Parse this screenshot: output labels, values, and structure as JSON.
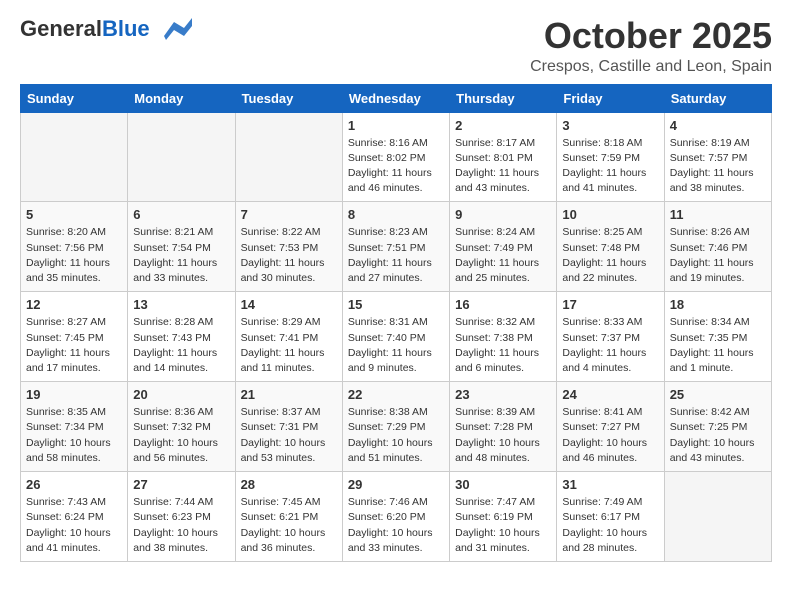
{
  "header": {
    "logo_general": "General",
    "logo_blue": "Blue",
    "month": "October 2025",
    "location": "Crespos, Castille and Leon, Spain"
  },
  "days_of_week": [
    "Sunday",
    "Monday",
    "Tuesday",
    "Wednesday",
    "Thursday",
    "Friday",
    "Saturday"
  ],
  "weeks": [
    [
      {
        "day": "",
        "info": ""
      },
      {
        "day": "",
        "info": ""
      },
      {
        "day": "",
        "info": ""
      },
      {
        "day": "1",
        "info": "Sunrise: 8:16 AM\nSunset: 8:02 PM\nDaylight: 11 hours\nand 46 minutes."
      },
      {
        "day": "2",
        "info": "Sunrise: 8:17 AM\nSunset: 8:01 PM\nDaylight: 11 hours\nand 43 minutes."
      },
      {
        "day": "3",
        "info": "Sunrise: 8:18 AM\nSunset: 7:59 PM\nDaylight: 11 hours\nand 41 minutes."
      },
      {
        "day": "4",
        "info": "Sunrise: 8:19 AM\nSunset: 7:57 PM\nDaylight: 11 hours\nand 38 minutes."
      }
    ],
    [
      {
        "day": "5",
        "info": "Sunrise: 8:20 AM\nSunset: 7:56 PM\nDaylight: 11 hours\nand 35 minutes."
      },
      {
        "day": "6",
        "info": "Sunrise: 8:21 AM\nSunset: 7:54 PM\nDaylight: 11 hours\nand 33 minutes."
      },
      {
        "day": "7",
        "info": "Sunrise: 8:22 AM\nSunset: 7:53 PM\nDaylight: 11 hours\nand 30 minutes."
      },
      {
        "day": "8",
        "info": "Sunrise: 8:23 AM\nSunset: 7:51 PM\nDaylight: 11 hours\nand 27 minutes."
      },
      {
        "day": "9",
        "info": "Sunrise: 8:24 AM\nSunset: 7:49 PM\nDaylight: 11 hours\nand 25 minutes."
      },
      {
        "day": "10",
        "info": "Sunrise: 8:25 AM\nSunset: 7:48 PM\nDaylight: 11 hours\nand 22 minutes."
      },
      {
        "day": "11",
        "info": "Sunrise: 8:26 AM\nSunset: 7:46 PM\nDaylight: 11 hours\nand 19 minutes."
      }
    ],
    [
      {
        "day": "12",
        "info": "Sunrise: 8:27 AM\nSunset: 7:45 PM\nDaylight: 11 hours\nand 17 minutes."
      },
      {
        "day": "13",
        "info": "Sunrise: 8:28 AM\nSunset: 7:43 PM\nDaylight: 11 hours\nand 14 minutes."
      },
      {
        "day": "14",
        "info": "Sunrise: 8:29 AM\nSunset: 7:41 PM\nDaylight: 11 hours\nand 11 minutes."
      },
      {
        "day": "15",
        "info": "Sunrise: 8:31 AM\nSunset: 7:40 PM\nDaylight: 11 hours\nand 9 minutes."
      },
      {
        "day": "16",
        "info": "Sunrise: 8:32 AM\nSunset: 7:38 PM\nDaylight: 11 hours\nand 6 minutes."
      },
      {
        "day": "17",
        "info": "Sunrise: 8:33 AM\nSunset: 7:37 PM\nDaylight: 11 hours\nand 4 minutes."
      },
      {
        "day": "18",
        "info": "Sunrise: 8:34 AM\nSunset: 7:35 PM\nDaylight: 11 hours\nand 1 minute."
      }
    ],
    [
      {
        "day": "19",
        "info": "Sunrise: 8:35 AM\nSunset: 7:34 PM\nDaylight: 10 hours\nand 58 minutes."
      },
      {
        "day": "20",
        "info": "Sunrise: 8:36 AM\nSunset: 7:32 PM\nDaylight: 10 hours\nand 56 minutes."
      },
      {
        "day": "21",
        "info": "Sunrise: 8:37 AM\nSunset: 7:31 PM\nDaylight: 10 hours\nand 53 minutes."
      },
      {
        "day": "22",
        "info": "Sunrise: 8:38 AM\nSunset: 7:29 PM\nDaylight: 10 hours\nand 51 minutes."
      },
      {
        "day": "23",
        "info": "Sunrise: 8:39 AM\nSunset: 7:28 PM\nDaylight: 10 hours\nand 48 minutes."
      },
      {
        "day": "24",
        "info": "Sunrise: 8:41 AM\nSunset: 7:27 PM\nDaylight: 10 hours\nand 46 minutes."
      },
      {
        "day": "25",
        "info": "Sunrise: 8:42 AM\nSunset: 7:25 PM\nDaylight: 10 hours\nand 43 minutes."
      }
    ],
    [
      {
        "day": "26",
        "info": "Sunrise: 7:43 AM\nSunset: 6:24 PM\nDaylight: 10 hours\nand 41 minutes."
      },
      {
        "day": "27",
        "info": "Sunrise: 7:44 AM\nSunset: 6:23 PM\nDaylight: 10 hours\nand 38 minutes."
      },
      {
        "day": "28",
        "info": "Sunrise: 7:45 AM\nSunset: 6:21 PM\nDaylight: 10 hours\nand 36 minutes."
      },
      {
        "day": "29",
        "info": "Sunrise: 7:46 AM\nSunset: 6:20 PM\nDaylight: 10 hours\nand 33 minutes."
      },
      {
        "day": "30",
        "info": "Sunrise: 7:47 AM\nSunset: 6:19 PM\nDaylight: 10 hours\nand 31 minutes."
      },
      {
        "day": "31",
        "info": "Sunrise: 7:49 AM\nSunset: 6:17 PM\nDaylight: 10 hours\nand 28 minutes."
      },
      {
        "day": "",
        "info": ""
      }
    ]
  ]
}
